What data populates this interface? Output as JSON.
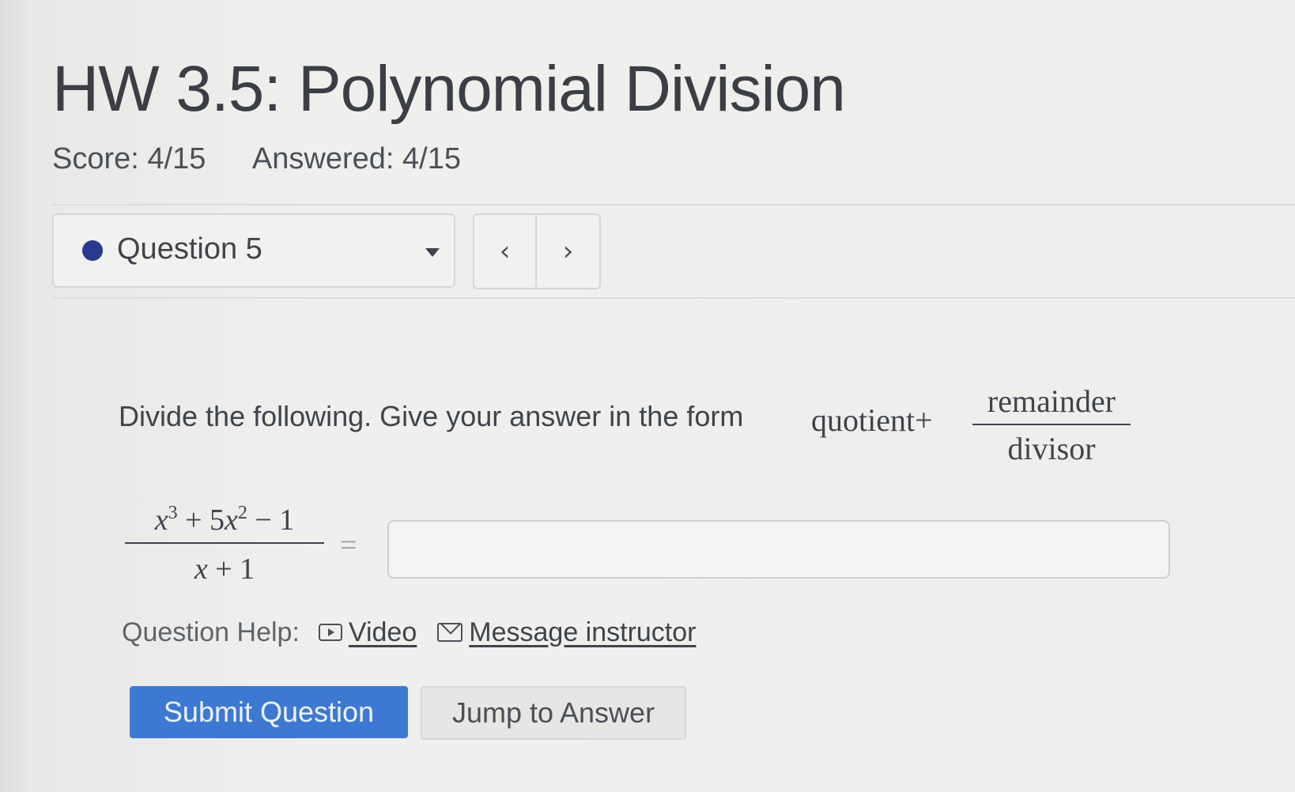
{
  "assignment": {
    "title": "HW 3.5: Polynomial Division",
    "score": "Score: 4/15",
    "answered": "Answered: 4/15"
  },
  "question_nav": {
    "selected_question": "Question 5",
    "prev_label": "‹",
    "next_label": "›"
  },
  "question": {
    "prompt_text": "Divide the following. Give your answer in the form ",
    "form_quotient": "quotient+",
    "form_numerator": "remainder",
    "form_denominator": "divisor",
    "expr_num_x": "x",
    "expr_num_exp1": "3",
    "expr_num_plus": " + 5",
    "expr_num_x2": "x",
    "expr_num_exp2": "2",
    "expr_num_minus": " − 1",
    "expr_den_x": "x",
    "expr_den_rest": " + 1",
    "equals": "=",
    "answer_value": ""
  },
  "help": {
    "label": "Question Help:",
    "video_icon": "video-icon",
    "video_label": "Video",
    "message_icon": "mail-icon",
    "message_label": "Message instructor"
  },
  "actions": {
    "submit_label": "Submit Question",
    "jump_label": "Jump to Answer"
  },
  "colors": {
    "accent": "#3d79d2",
    "status_dot": "#273a8f"
  }
}
